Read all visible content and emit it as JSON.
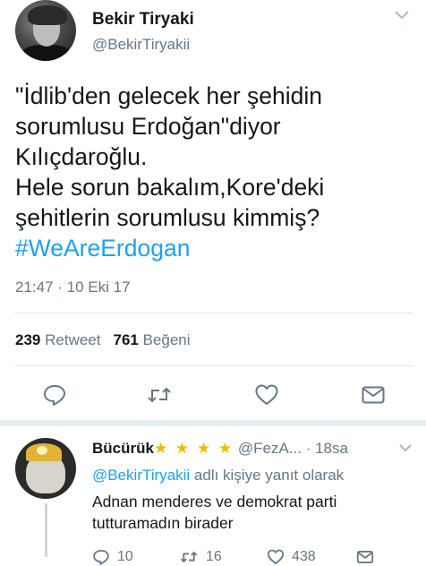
{
  "tweet": {
    "author_name": "Bekir Tiryaki",
    "author_handle": "@BekirTiryakii",
    "text_lines": [
      "\"İdlib'den gelecek her şehidin",
      "sorumlusu Erdoğan\"diyor",
      "Kılıçdaroğlu.",
      "Hele sorun bakalım,Kore'deki",
      "şehitlerin sorumlusu kimmiş?"
    ],
    "hashtag": "#WeAreErdogan",
    "timestamp": "21:47 · 10 Eki 17",
    "retweet_count": "239",
    "retweet_label": "Retweet",
    "like_count": "761",
    "like_label": "Beğeni",
    "actions": [
      {
        "icon": "reply-icon"
      },
      {
        "icon": "retweet-icon"
      },
      {
        "icon": "heart-icon"
      },
      {
        "icon": "message-icon"
      }
    ]
  },
  "reply": {
    "author_name": "Bücürük",
    "stars": "★ ★ ★ ★",
    "author_handle": "@FezA...",
    "time": "· 18sa",
    "reply_to_mention": "@BekirTiryakii",
    "reply_to_suffix": " adlı kişiye yanıt olarak",
    "text_lines": [
      "Adnan menderes ve demokrat parti",
      "tutturamadın birader"
    ],
    "reply_count": "10",
    "retweet_count": "16",
    "like_count": "438"
  },
  "colors": {
    "link": "#1da1f2",
    "secondary_text": "#657786",
    "primary_text": "#14171a",
    "divider": "#e1e8ed",
    "star": "#f5b800"
  }
}
